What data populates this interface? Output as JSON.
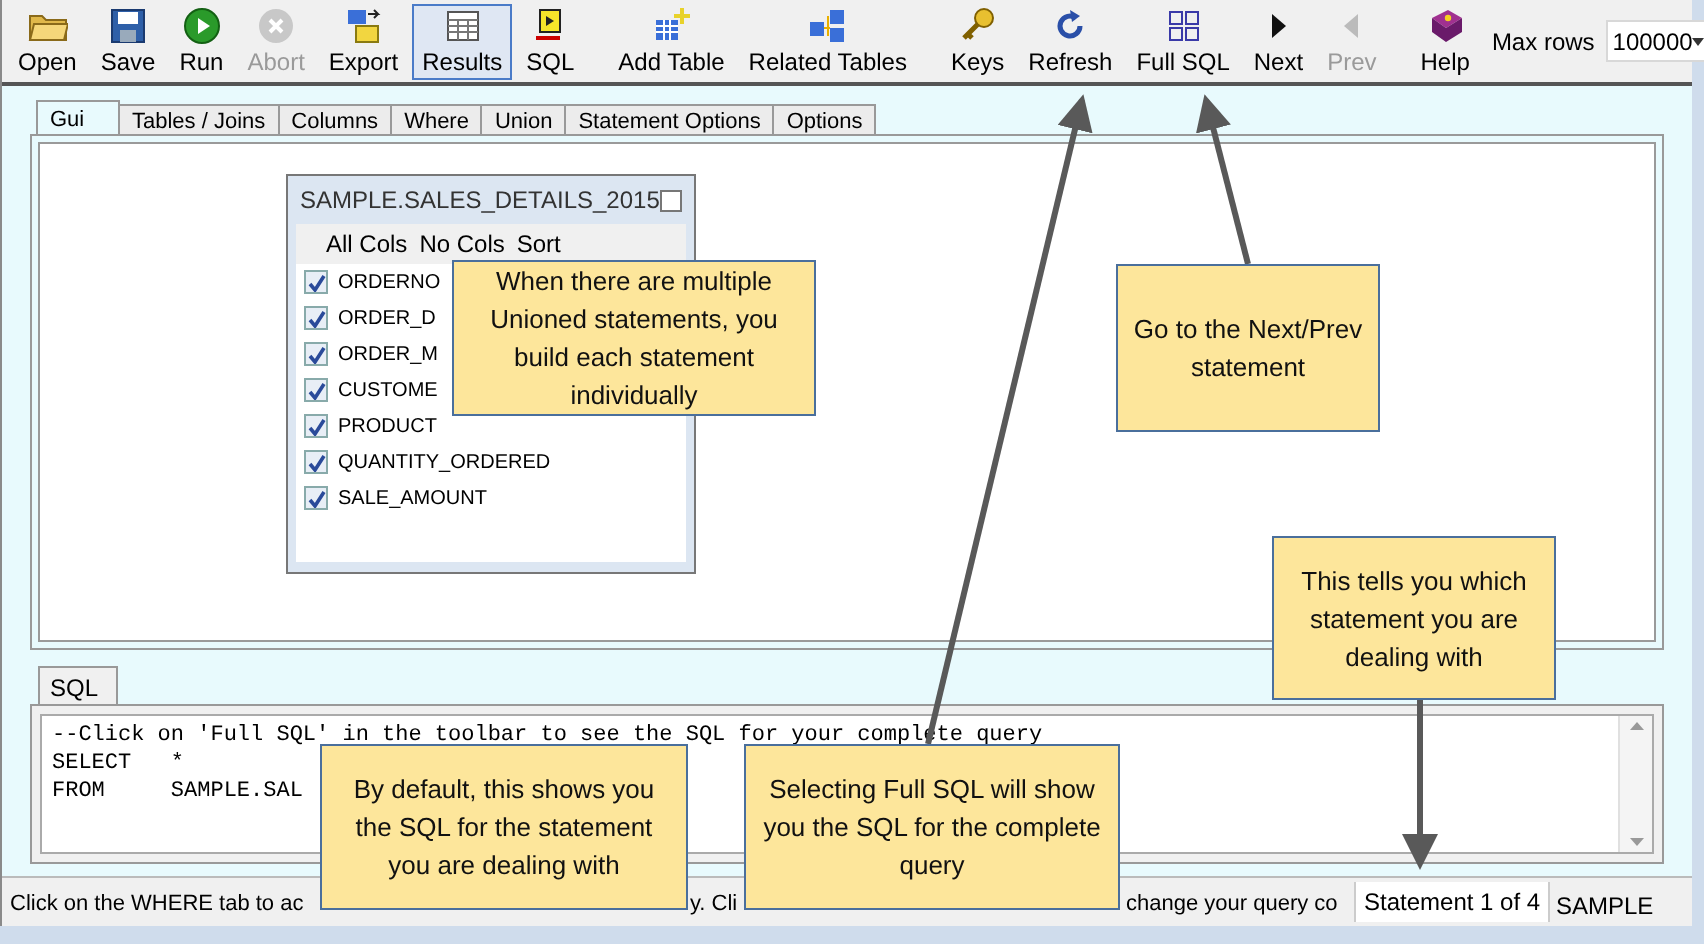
{
  "toolbar": {
    "items": [
      {
        "kind": "button",
        "label": "Open",
        "disabled": false,
        "selected": false
      },
      {
        "kind": "button",
        "label": "Save",
        "disabled": false,
        "selected": false
      },
      {
        "kind": "button",
        "label": "Run",
        "disabled": false,
        "selected": false
      },
      {
        "kind": "button",
        "label": "Abort",
        "disabled": true,
        "selected": false
      },
      {
        "kind": "button",
        "label": "Export",
        "disabled": false,
        "selected": false
      },
      {
        "kind": "button",
        "label": "Results",
        "disabled": false,
        "selected": true
      },
      {
        "kind": "button",
        "label": "SQL",
        "disabled": false,
        "selected": false
      },
      {
        "kind": "separator"
      },
      {
        "kind": "button",
        "label": "Add Table",
        "disabled": false,
        "selected": false
      },
      {
        "kind": "button",
        "label": "Related Tables",
        "disabled": false,
        "selected": false
      },
      {
        "kind": "separator"
      },
      {
        "kind": "button",
        "label": "Keys",
        "disabled": false,
        "selected": false
      },
      {
        "kind": "button",
        "label": "Refresh",
        "disabled": false,
        "selected": false
      },
      {
        "kind": "button",
        "label": "Full SQL",
        "disabled": false,
        "selected": false
      },
      {
        "kind": "button",
        "label": "Next",
        "disabled": false,
        "selected": false
      },
      {
        "kind": "button",
        "label": "Prev",
        "disabled": true,
        "selected": false
      },
      {
        "kind": "separator"
      },
      {
        "kind": "button",
        "label": "Help",
        "disabled": false,
        "selected": false
      },
      {
        "kind": "combo",
        "label": "Max rows",
        "value": "100000"
      }
    ]
  },
  "tabs": [
    {
      "label": "Gui",
      "selected": true
    },
    {
      "label": "Tables / Joins",
      "selected": false
    },
    {
      "label": "Columns",
      "selected": false
    },
    {
      "label": "Where",
      "selected": false
    },
    {
      "label": "Union",
      "selected": false
    },
    {
      "label": "Statement Options",
      "selected": false
    },
    {
      "label": "Options",
      "selected": false
    }
  ],
  "table_window": {
    "title": "SAMPLE.SALES_DETAILS_2015",
    "links": [
      "All Cols",
      "No Cols",
      "Sort"
    ],
    "columns": [
      {
        "name": "ORDERNO",
        "checked": true
      },
      {
        "name": "ORDER_D",
        "checked": true
      },
      {
        "name": "ORDER_M",
        "checked": true
      },
      {
        "name": "CUSTOME",
        "checked": true
      },
      {
        "name": "PRODUCT",
        "checked": true
      },
      {
        "name": "QUANTITY_ORDERED",
        "checked": true
      },
      {
        "name": "SALE_AMOUNT",
        "checked": true
      }
    ]
  },
  "sql_panel": {
    "tabs": [
      {
        "label": "SQL",
        "selected": true
      }
    ],
    "lines": [
      "--Click on 'Full SQL' in the toolbar to see the SQL for your complete query",
      "SELECT   *",
      "FROM     SAMPLE.SAL"
    ]
  },
  "status_bar": {
    "message_parts": [
      "Click on the WHERE tab to ac",
      "y. Cli",
      "change your query co"
    ],
    "statement": "Statement 1 of 4",
    "database": "SAMPLE"
  },
  "callouts": [
    "When there are multiple Unioned statements, you build each statement individually",
    "Go to the Next/Prev statement",
    "This tells you which statement you are dealing with",
    "By default, this shows you the SQL for the statement you are dealing with",
    "Selecting Full SQL will show you the SQL for the complete query"
  ]
}
